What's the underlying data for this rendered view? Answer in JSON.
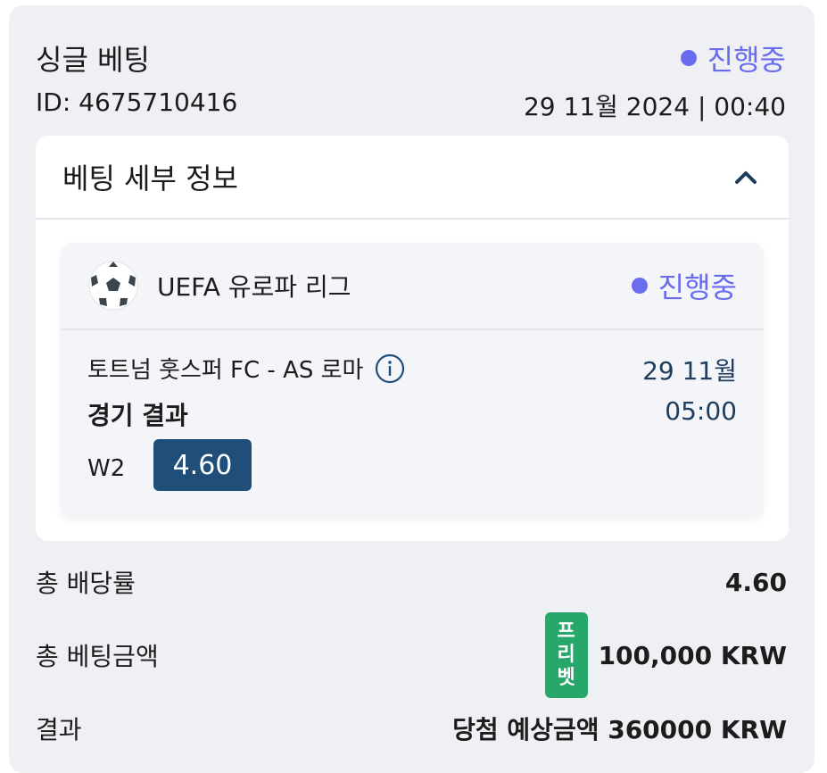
{
  "header": {
    "title": "싱글 베팅",
    "status": "진행중",
    "id_text": "ID: 4675710416",
    "date_text": "29 11월 2024 | 00:40"
  },
  "details": {
    "title": "베팅 세부 정보",
    "league": "UEFA 유로파 리그",
    "status": "진행중",
    "match": "토트넘 훗스퍼 FC - AS 로마",
    "match_date": "29 11월",
    "match_time": "05:00",
    "market": "경기 결과",
    "selection": "W2",
    "odds": "4.60"
  },
  "summary": {
    "total_odds_label": "총 배당률",
    "total_odds_value": "4.60",
    "total_stake_label": "총 베팅금액",
    "freebet_chars": [
      "프",
      "리",
      "벳"
    ],
    "total_stake_value": "100,000 KRW",
    "result_label": "결과",
    "result_value": "당첨 예상금액 360000 KRW"
  },
  "colors": {
    "status": "#6a6cf0",
    "odds_badge": "#1f4e79",
    "freebet_badge": "#27a86a",
    "card_bg": "#eef0f4"
  },
  "icons": {
    "chevron": "chevron-up-icon",
    "ball": "soccer-ball-icon",
    "info": "info-icon"
  }
}
